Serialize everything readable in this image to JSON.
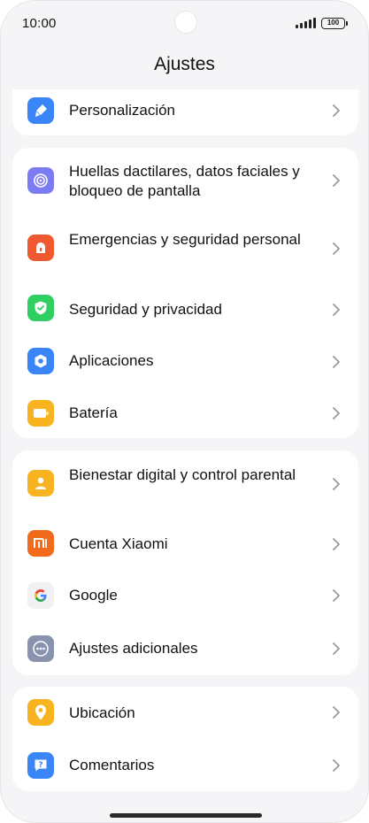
{
  "status_bar": {
    "time": "10:00",
    "battery": "100"
  },
  "header": {
    "title": "Ajustes"
  },
  "items": [
    {
      "id": "personalizacion",
      "label": "Personalización",
      "icon": "brush-icon",
      "color": "#3a85f7"
    },
    {
      "id": "huellas",
      "label": "Huellas dactilares, datos faciales y bloqueo de pantalla",
      "icon": "fingerprint-icon",
      "color": "#7c7cf2"
    },
    {
      "id": "emergencias",
      "label": "Emergencias y seguridad personal",
      "icon": "siren-icon",
      "color": "#f0592f"
    },
    {
      "id": "seguridad",
      "label": "Seguridad y privacidad",
      "icon": "shield-check-icon",
      "color": "#2fcf62"
    },
    {
      "id": "aplicaciones",
      "label": "Aplicaciones",
      "icon": "hexagon-icon",
      "color": "#3a85f7"
    },
    {
      "id": "bateria",
      "label": "Batería",
      "icon": "battery-icon",
      "color": "#f7b320"
    },
    {
      "id": "bienestar",
      "label": "Bienestar digital y control parental",
      "icon": "person-icon",
      "color": "#f7b320"
    },
    {
      "id": "xiaomi",
      "label": "Cuenta Xiaomi",
      "icon": "mi-logo-icon",
      "color": "#f26b1d"
    },
    {
      "id": "google",
      "label": "Google",
      "icon": "google-g-icon",
      "color": "#f1f1f3"
    },
    {
      "id": "adicionales",
      "label": "Ajustes adicionales",
      "icon": "more-dots-icon",
      "color": "#8a93ad"
    },
    {
      "id": "ubicacion",
      "label": "Ubicación",
      "icon": "location-pin-icon",
      "color": "#f7b320"
    },
    {
      "id": "comentarios",
      "label": "Comentarios",
      "icon": "feedback-icon",
      "color": "#3a85f7"
    }
  ]
}
